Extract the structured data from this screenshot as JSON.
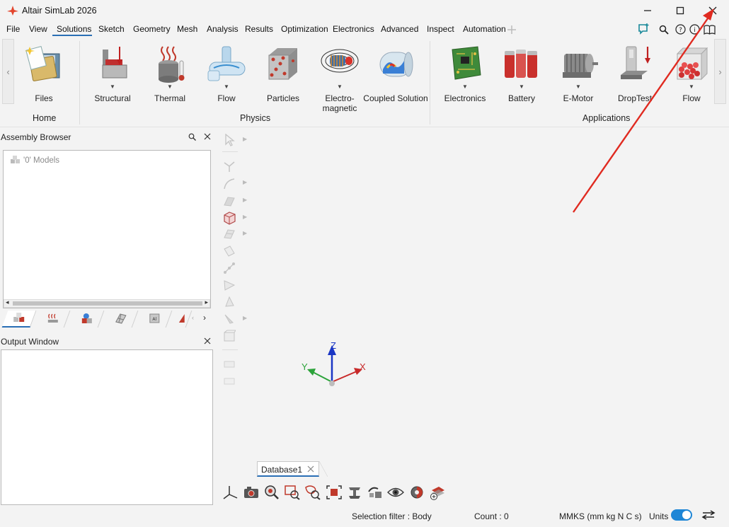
{
  "window": {
    "title": "Altair SimLab 2026",
    "accent": "#2a6fb5",
    "annotation_color": "#e02a20"
  },
  "menu": {
    "items": [
      "File",
      "View",
      "Solutions",
      "Sketch",
      "Geometry",
      "Mesh",
      "Analysis",
      "Results",
      "Optimization",
      "Electronics",
      "Advanced",
      "Inspect",
      "Automation"
    ],
    "active": "Solutions"
  },
  "ribbon": {
    "home_group": {
      "label": "Home",
      "tools": [
        {
          "label": "Files",
          "icon": "files-icon"
        }
      ]
    },
    "physics_group": {
      "label": "Physics",
      "tools": [
        {
          "label": "Structural",
          "icon": "structural-icon"
        },
        {
          "label": "Thermal",
          "icon": "thermal-icon"
        },
        {
          "label": "Flow",
          "icon": "flow-icon"
        },
        {
          "label": "Particles",
          "icon": "particles-icon"
        },
        {
          "label": "Electro-\nmagnetic",
          "icon": "electromagnetic-icon"
        },
        {
          "label": "Coupled Solution",
          "icon": "coupled-solution-icon"
        }
      ]
    },
    "applications_group": {
      "label": "Applications",
      "tools": [
        {
          "label": "Electronics",
          "icon": "electronics-icon"
        },
        {
          "label": "Battery",
          "icon": "battery-icon"
        },
        {
          "label": "E-Motor",
          "icon": "emotor-icon"
        },
        {
          "label": "DropTest",
          "icon": "droptest-icon"
        },
        {
          "label": "Flow",
          "icon": "app-flow-icon"
        }
      ]
    }
  },
  "assembly_browser": {
    "title": "Assembly Browser",
    "tree_root": "'0' Models"
  },
  "output_window": {
    "title": "Output Window"
  },
  "viewport": {
    "axis_x": "X",
    "axis_y": "Y",
    "axis_z": "Z",
    "database_tab": "Database1"
  },
  "status": {
    "selection_filter": "Selection filter : Body",
    "count": "Count : 0",
    "units_system": "MMKS (mm kg N C s)",
    "units_label": "Units",
    "units_toggle_on": true
  }
}
